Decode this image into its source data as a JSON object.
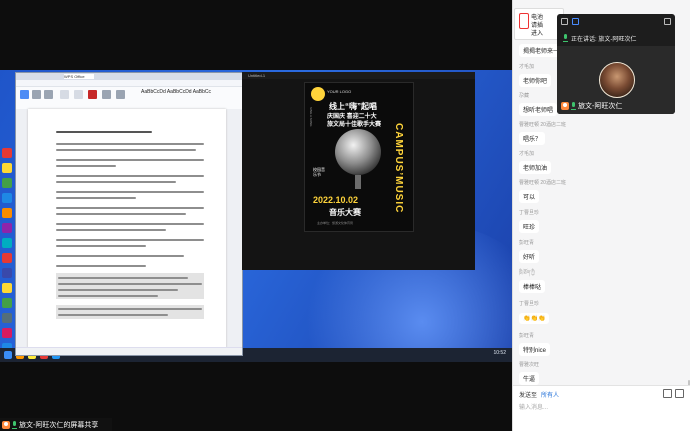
{
  "share": {
    "presenter_label": "旅文-阿旺次仁的屏幕共享"
  },
  "word_window": {
    "tab_label": "WPS Office",
    "font_sample": "AaBbCcDd AaBbCcDd AaBbCc",
    "doc_title_line": "线上“嗨”起唱庆国庆喜迎二十大文艺活动工作方案"
  },
  "poster_window": {
    "title": "Untitled-1",
    "poster": {
      "logo_text": "YOUR LOGO",
      "headline_1": "线上“嗨”起唱",
      "headline_2": "庆国庆 喜迎二十大",
      "headline_3": "旅文局十佳歌手大赛",
      "vertical_text": "CAMPUS’MUSIC",
      "tag_text": "校园音乐节",
      "date": "2022.10.02",
      "title": "音乐大赛",
      "footer": "主办单位：旅游文化体育局"
    }
  },
  "notification": {
    "line1": "电池",
    "line2": "请插",
    "line3": "进入"
  },
  "speaker_panel": {
    "now_speaking": "正在讲话: 旅文-阿旺次仁",
    "name": "旅文-阿旺次仁"
  },
  "chat": {
    "messages": [
      {
        "name": "",
        "text": "揭揭老师来一首"
      },
      {
        "name": "才毛加",
        "text": "老师你吧"
      },
      {
        "name": "尕藏",
        "text": "想听老师唱"
      },
      {
        "name": "曹雅旺顿 20酒店二班",
        "text": "唱乐？"
      },
      {
        "name": "才毛加",
        "text": "老师加油"
      },
      {
        "name": "曹雅旺顿 20酒店二班",
        "text": "可以"
      },
      {
        "name": "丁曹旦珍",
        "text": "旺珍"
      },
      {
        "name": "彭旺青",
        "text": "好听"
      },
      {
        "name": "ཁྲི་ཐོག་ཀྱི",
        "text": "棒棒哒"
      },
      {
        "name": "丁曹旦珍",
        "text": "👏👏👏"
      },
      {
        "name": "彭旺青",
        "text": "特别nice"
      },
      {
        "name": "曹雅次旺",
        "text": "牛逼"
      }
    ],
    "send_to_label": "发送至",
    "send_to_value": "所有人",
    "input_placeholder": "输入消息..."
  },
  "taskbar": {
    "time": "10:52"
  }
}
